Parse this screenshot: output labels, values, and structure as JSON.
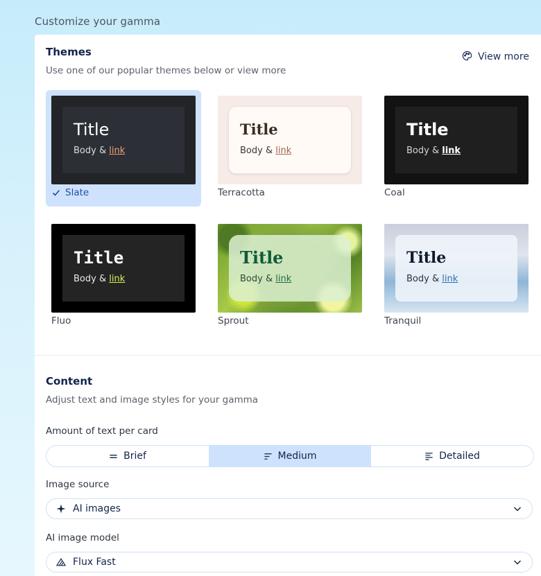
{
  "page": {
    "title": "Customize your gamma"
  },
  "themes": {
    "title": "Themes",
    "subtitle": "Use one of our popular themes below or view more",
    "view_more": "View more",
    "items": [
      {
        "name": "Slate",
        "selected": true,
        "preview_title": "Title",
        "preview_body": "Body &",
        "preview_link": "link"
      },
      {
        "name": "Terracotta",
        "selected": false,
        "preview_title": "Title",
        "preview_body": "Body &",
        "preview_link": "link"
      },
      {
        "name": "Coal",
        "selected": false,
        "preview_title": "Title",
        "preview_body": "Body &",
        "preview_link": "link"
      },
      {
        "name": "Fluo",
        "selected": false,
        "preview_title": "Title",
        "preview_body": "Body &",
        "preview_link": "link"
      },
      {
        "name": "Sprout",
        "selected": false,
        "preview_title": "Title",
        "preview_body": "Body &",
        "preview_link": "link"
      },
      {
        "name": "Tranquil",
        "selected": false,
        "preview_title": "Title",
        "preview_body": "Body &",
        "preview_link": "link"
      }
    ]
  },
  "content": {
    "title": "Content",
    "subtitle": "Adjust text and image styles for your gamma",
    "text_amount": {
      "label": "Amount of text per card",
      "options": [
        {
          "label": "Brief",
          "icon": "equals-icon",
          "active": false
        },
        {
          "label": "Medium",
          "icon": "lines-medium-icon",
          "active": true
        },
        {
          "label": "Detailed",
          "icon": "lines-detailed-icon",
          "active": false
        }
      ]
    },
    "image_source": {
      "label": "Image source",
      "value": "AI images",
      "icon": "sparkle-icon"
    },
    "image_model": {
      "label": "AI image model",
      "value": "Flux Fast",
      "icon": "flux-triangle-icon"
    }
  },
  "colors": {
    "accent": "#cfe2fd",
    "heading": "#12244b",
    "border": "#cfe2f3"
  }
}
